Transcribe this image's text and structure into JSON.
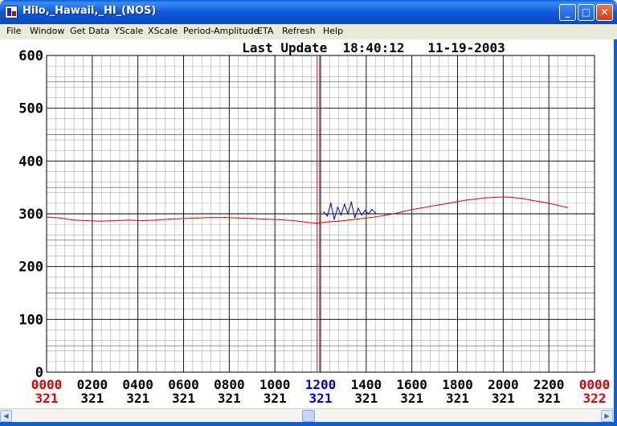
{
  "window": {
    "title": "Hilo,_Hawaii,_HI_(NOS)",
    "minimize_glyph": "_",
    "maximize_glyph": "□",
    "close_glyph": "✕"
  },
  "menu": [
    "File",
    "Window",
    "Get Data",
    "YScale",
    "XScale",
    "Period-Amplitude",
    "ETA",
    "Refresh",
    "Help"
  ],
  "header": {
    "last_update": "Last Update  18:40:12   11-19-2003"
  },
  "colors": {
    "title_gradient": "#0a5fd8",
    "red_series": "#e00000",
    "blue_series": "#0000cc",
    "grid_major": "#000000",
    "grid_minor": "#aaaaaa"
  },
  "chart_data": {
    "type": "line",
    "title": "Last Update  18:40:12   11-19-2003",
    "xlabel": "",
    "ylabel": "",
    "ylim": [
      0,
      600
    ],
    "xlim": [
      0,
      2400
    ],
    "yticks": [
      "0",
      "100",
      "200",
      "300",
      "400",
      "500",
      "600"
    ],
    "xticks": [
      {
        "time": "0000",
        "day": "321",
        "highlight": "red"
      },
      {
        "time": "0200",
        "day": "321",
        "highlight": "none"
      },
      {
        "time": "0400",
        "day": "321",
        "highlight": "none"
      },
      {
        "time": "0600",
        "day": "321",
        "highlight": "none"
      },
      {
        "time": "0800",
        "day": "321",
        "highlight": "none"
      },
      {
        "time": "1000",
        "day": "321",
        "highlight": "none"
      },
      {
        "time": "1200",
        "day": "321",
        "highlight": "blue"
      },
      {
        "time": "1400",
        "day": "321",
        "highlight": "none"
      },
      {
        "time": "1600",
        "day": "321",
        "highlight": "none"
      },
      {
        "time": "1800",
        "day": "321",
        "highlight": "none"
      },
      {
        "time": "2000",
        "day": "321",
        "highlight": "none"
      },
      {
        "time": "2200",
        "day": "321",
        "highlight": "none"
      },
      {
        "time": "0000",
        "day": "322",
        "highlight": "red"
      }
    ],
    "marker_time": 1185,
    "series": [
      {
        "color": "red",
        "x": [
          0,
          60,
          120,
          180,
          240,
          300,
          360,
          420,
          480,
          540,
          600,
          660,
          720,
          780,
          840,
          900,
          960,
          1020,
          1080,
          1140,
          1180,
          1200,
          1240,
          1280,
          1320,
          1360,
          1400,
          1440,
          1480,
          1520,
          1560,
          1600,
          1640,
          1680,
          1720,
          1760,
          1800,
          1840,
          1880,
          1920,
          1960,
          2000,
          2040,
          2080,
          2120,
          2160,
          2200,
          2240,
          2280
        ],
        "y": [
          294,
          292,
          288,
          287,
          286,
          287,
          288,
          287,
          288,
          290,
          291,
          292,
          293,
          293,
          292,
          291,
          290,
          289,
          287,
          284,
          282,
          283,
          285,
          286,
          288,
          290,
          292,
          294,
          297,
          300,
          304,
          308,
          311,
          314,
          317,
          320,
          323,
          326,
          328,
          330,
          331,
          332,
          331,
          329,
          326,
          323,
          320,
          316,
          312
        ]
      },
      {
        "color": "blue",
        "x": [
          1215,
          1230,
          1245,
          1260,
          1275,
          1290,
          1305,
          1320,
          1335,
          1350,
          1365,
          1380,
          1395,
          1410,
          1425,
          1440
        ],
        "y": [
          303,
          296,
          320,
          290,
          312,
          298,
          318,
          300,
          322,
          293,
          310,
          298,
          306,
          300,
          308,
          302
        ]
      }
    ]
  },
  "scrollbar": {
    "left_arrow": "◀",
    "right_arrow": "▶"
  }
}
